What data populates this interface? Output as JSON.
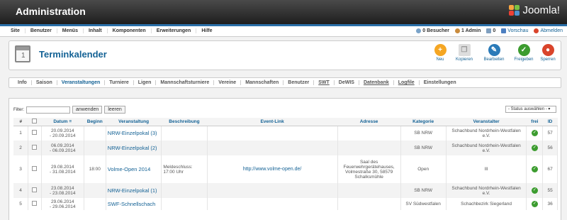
{
  "header": {
    "title": "Administration",
    "logo_text": "Joomla!"
  },
  "menu": [
    "Site",
    "Benutzer",
    "Menüs",
    "Inhalt",
    "Komponenten",
    "Erweiterungen",
    "Hilfe"
  ],
  "status": {
    "visitors": "0 Besucher",
    "admins": "1 Admin",
    "messages": "0",
    "preview": "Vorschau",
    "logout": "Abmelden"
  },
  "toolbar": {
    "title": "Terminkalender",
    "calendar_day": "1",
    "buttons": [
      {
        "label": "Neu",
        "icon": "plus-icon",
        "color": "#f5a623"
      },
      {
        "label": "Kopieren",
        "icon": "copy-icon",
        "color": "#cccccc"
      },
      {
        "label": "Bearbeiten",
        "icon": "edit-icon",
        "color": "#2a7ab8"
      },
      {
        "label": "Freigeben",
        "icon": "check-icon",
        "color": "#3c9c2f"
      },
      {
        "label": "Sperren",
        "icon": "stop-icon",
        "color": "#d9442b"
      }
    ]
  },
  "subnav": [
    "Info",
    "Saison",
    "Veranstaltungen",
    "Turniere",
    "Ligen",
    "Mannschaftsturniere",
    "Vereine",
    "Mannschaften",
    "Benutzer",
    "SWT",
    "DeWIS",
    "Datenbank",
    "Logfile",
    "Einstellungen"
  ],
  "filter": {
    "label": "Filter:",
    "apply": "anwenden",
    "clear": "leeren",
    "status_select": "- Status auswählen -"
  },
  "table": {
    "headers": [
      "#",
      "",
      "Datum",
      "Beginn",
      "Veranstaltung",
      "Beschreibung",
      "Event-Link",
      "Adresse",
      "Kategorie",
      "Veranstalter",
      "frei",
      "ID"
    ],
    "rows": [
      {
        "num": "1",
        "date": "20.09.2014\n- 20.09.2014",
        "begin": "",
        "event": "NRW-Einzelpokal (3)",
        "desc": "",
        "link": "",
        "address": "",
        "category": "SB NRW",
        "organizer": "Schachbund Nordrhein-Westfalen e.V.",
        "id": "57"
      },
      {
        "num": "2",
        "date": "06.09.2014\n- 06.09.2014",
        "begin": "",
        "event": "NRW-Einzelpokal (2)",
        "desc": "",
        "link": "",
        "address": "",
        "category": "SB NRW",
        "organizer": "Schachbund Nordrhein-Westfalen e.V.",
        "id": "56"
      },
      {
        "num": "3",
        "date": "29.08.2014\n- 31.08.2014",
        "begin": "18:00",
        "event": "Volme-Open 2014",
        "desc": "Meldeschluss:\n17:00 Uhr",
        "link": "http://www.volme-open.de/",
        "address": "Saal des\nFeuerwehrgerätehauses,\nVolmestraße 30, 58579\nSchalksmühle",
        "category": "Open",
        "organizer": "lll",
        "id": "67"
      },
      {
        "num": "4",
        "date": "23.08.2014\n- 23.08.2014",
        "begin": "",
        "event": "NRW-Einzelpokal (1)",
        "desc": "",
        "link": "",
        "address": "",
        "category": "SB NRW",
        "organizer": "Schachbund Nordrhein-Westfalen e.V.",
        "id": "55"
      },
      {
        "num": "5",
        "date": "29.06.2014\n- 29.06.2014",
        "begin": "",
        "event": "SWF-Schnellschach",
        "desc": "",
        "link": "",
        "address": "",
        "category": "SV Südwestfalen",
        "organizer": "Schachbezirk Siegerland",
        "id": "36"
      }
    ]
  }
}
